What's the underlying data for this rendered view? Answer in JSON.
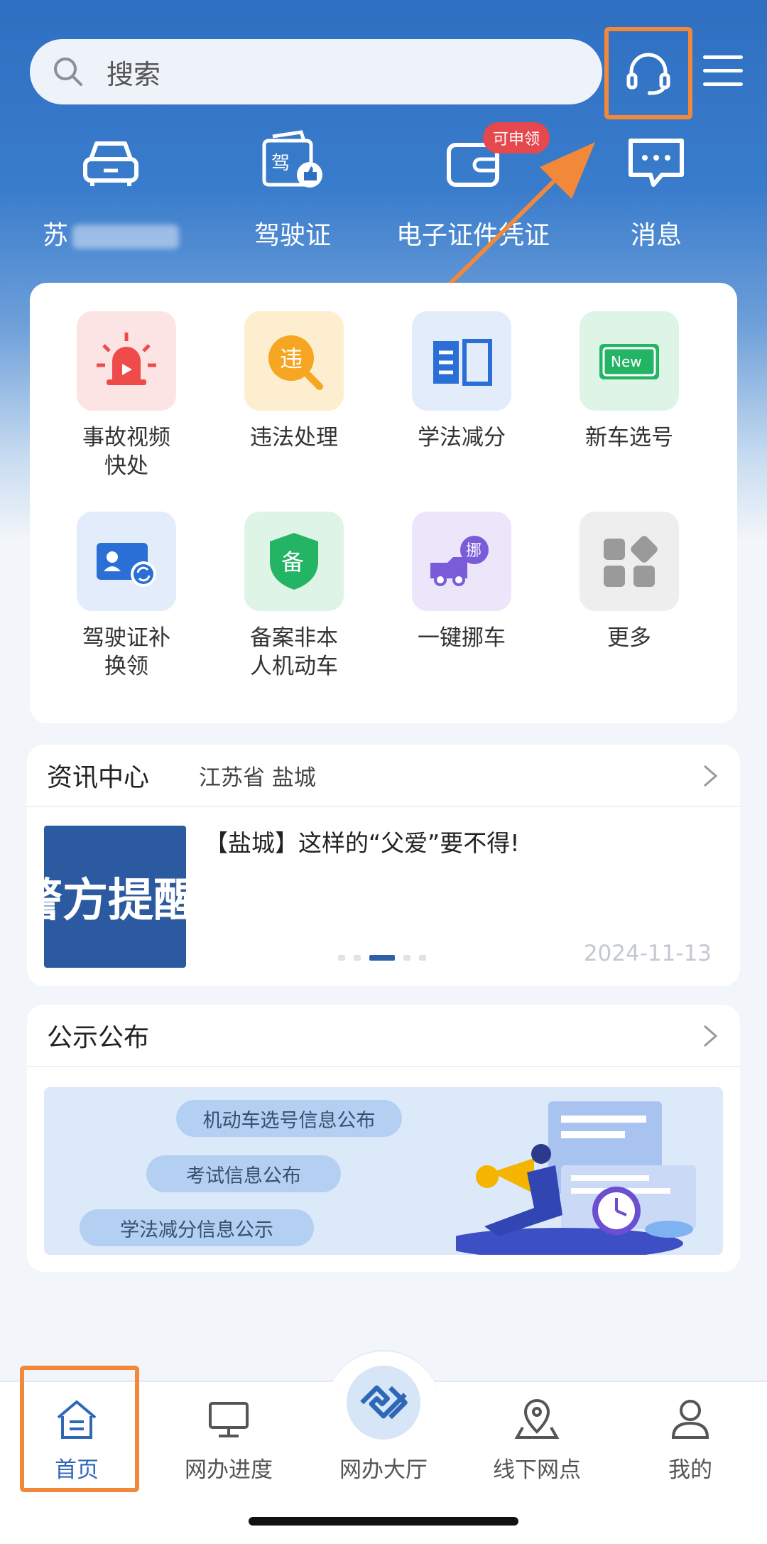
{
  "search": {
    "placeholder": "搜索"
  },
  "quick": [
    {
      "label": "苏",
      "icon": "car-icon",
      "blurred_suffix": true
    },
    {
      "label": "驾驶证",
      "icon": "license-icon"
    },
    {
      "label": "电子证件凭证",
      "icon": "wallet-icon",
      "badge": "可申领"
    },
    {
      "label": "消息",
      "icon": "message-icon"
    }
  ],
  "services": [
    {
      "label": "事故视频\n快处",
      "icon": "alarm-light-icon"
    },
    {
      "label": "违法处理",
      "icon": "violation-icon",
      "glyph": "违"
    },
    {
      "label": "学法减分",
      "icon": "book-icon"
    },
    {
      "label": "新车选号",
      "icon": "new-plate-icon",
      "glyph": "New"
    },
    {
      "label": "驾驶证补\n换领",
      "icon": "id-card-swap-icon"
    },
    {
      "label": "备案非本\n人机动车",
      "icon": "shield-icon",
      "glyph": "备"
    },
    {
      "label": "一键挪车",
      "icon": "truck-icon",
      "glyph": "挪"
    },
    {
      "label": "更多",
      "icon": "grid-icon"
    }
  ],
  "news": {
    "title": "资讯中心",
    "region": "江苏省 盐城",
    "thumb_text": "警方提醒",
    "headline": "【盐城】这样的“父爱”要不得!",
    "date": "2024-11-13",
    "carousel": {
      "count": 5,
      "active": 2
    }
  },
  "notice": {
    "title": "公示公布",
    "pills": [
      "机动车选号信息公布",
      "考试信息公布",
      "学法减分信息公示"
    ]
  },
  "nav": [
    {
      "label": "首页",
      "icon": "home-icon",
      "active": true
    },
    {
      "label": "网办进度",
      "icon": "monitor-icon"
    },
    {
      "label": "网办大厅",
      "icon": "hall-icon"
    },
    {
      "label": "线下网点",
      "icon": "location-pin-icon"
    },
    {
      "label": "我的",
      "icon": "user-icon"
    }
  ],
  "colors": {
    "primary": "#2e6fc1",
    "highlight": "#f2883a",
    "badge": "#e5484d"
  }
}
